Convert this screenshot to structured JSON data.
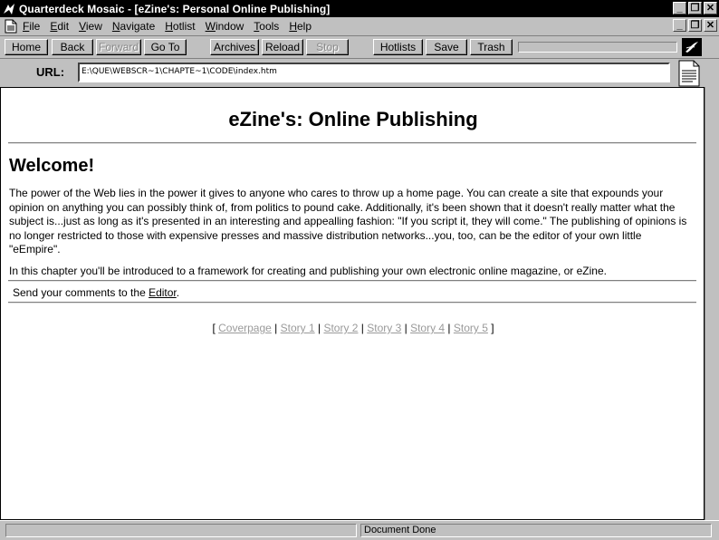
{
  "window": {
    "title": "Quarterdeck Mosaic - [eZine's:  Personal Online Publishing]",
    "controls": {
      "minimize": "_",
      "restore": "❐",
      "close": "✕"
    }
  },
  "menu": {
    "items": [
      "File",
      "Edit",
      "View",
      "Navigate",
      "Hotlist",
      "Window",
      "Tools",
      "Help"
    ]
  },
  "toolbar": {
    "home": "Home",
    "back": "Back",
    "forward": "Forward",
    "goto": "Go To",
    "archives": "Archives",
    "reload": "Reload",
    "stop": "Stop",
    "hotlists": "Hotlists",
    "save": "Save",
    "trash": "Trash"
  },
  "url": {
    "label": "URL:",
    "value": "E:\\QUE\\WEBSCR~1\\CHAPTE~1\\CODE\\index.htm"
  },
  "page": {
    "title": "eZine's: Online Publishing",
    "heading": "Welcome!",
    "paragraph1": "The power of the Web lies in the power it gives to anyone who cares to throw up a home page. You can create a site that expounds your opinion on anything you can possibly think of, from politics to pound cake. Additionally, it's been shown that it doesn't really matter what the subject is...just as long as it's presented in an interesting and appealling fashion: \"If you script it, they will come.\" The publishing of opinions is no longer restricted to those with expensive presses and massive distribution networks...you, too, can be the editor of your own little \"eEmpire\".",
    "paragraph2": "In this chapter you'll be introduced to a framework for creating and publishing your own electronic online magazine, or eZine.",
    "comments_prefix": "Send your comments to the ",
    "comments_link": "Editor",
    "comments_suffix": ".",
    "nav": {
      "open": "[ ",
      "sep": " | ",
      "close": " ]",
      "links": [
        "Coverpage",
        "Story 1",
        "Story 2",
        "Story 3",
        "Story 4",
        "Story 5"
      ]
    }
  },
  "status": {
    "text": "Document Done"
  },
  "colors": {
    "chrome": "#c0c0c0",
    "titlebar": "#000000",
    "visited_link": "#9a9a9a"
  }
}
